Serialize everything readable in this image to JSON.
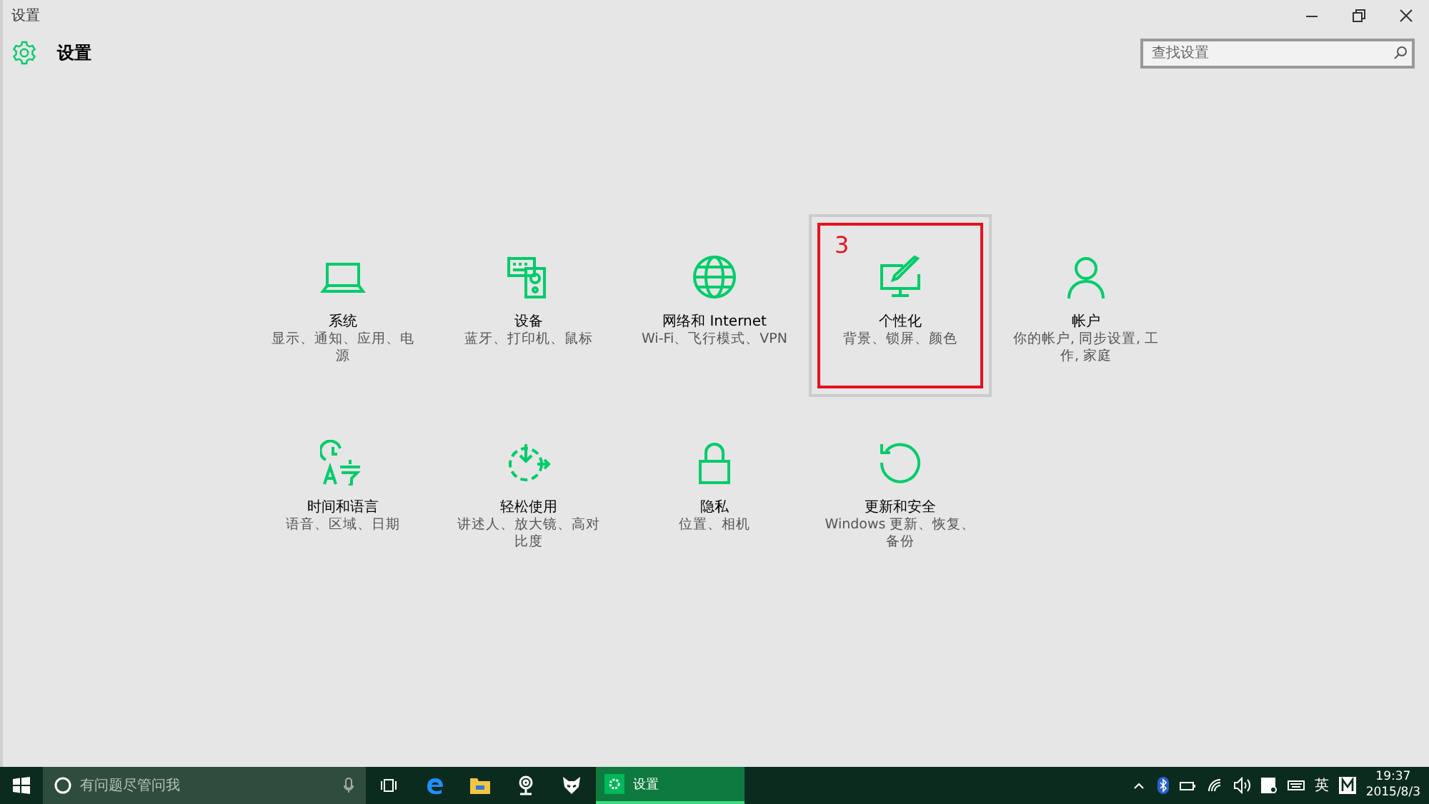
{
  "window": {
    "title": "设置",
    "header": "设置",
    "search": {
      "placeholder": "查找设置"
    }
  },
  "tiles": [
    {
      "title": "系统",
      "desc": "显示、通知、应用、电源",
      "selected": false
    },
    {
      "title": "设备",
      "desc": "蓝牙、打印机、鼠标",
      "selected": false
    },
    {
      "title": "网络和 Internet",
      "desc": "Wi-Fi、飞行模式、VPN",
      "selected": false
    },
    {
      "title": "个性化",
      "desc": "背景、锁屏、颜色",
      "selected": true,
      "annotation": "3"
    },
    {
      "title": "帐户",
      "desc": "你的帐户, 同步设置, 工作, 家庭",
      "selected": false
    },
    {
      "title": "时间和语言",
      "desc": "语音、区域、日期",
      "selected": false
    },
    {
      "title": "轻松使用",
      "desc": "讲述人、放大镜、高对比度",
      "selected": false
    },
    {
      "title": "隐私",
      "desc": "位置、相机",
      "selected": false
    },
    {
      "title": "更新和安全",
      "desc": "Windows 更新、恢复、备份",
      "selected": false
    }
  ],
  "taskbar": {
    "search_placeholder": "有问题尽管问我",
    "active_app": "设置",
    "ime": "英",
    "time": "19:37",
    "date": "2015/8/3"
  }
}
